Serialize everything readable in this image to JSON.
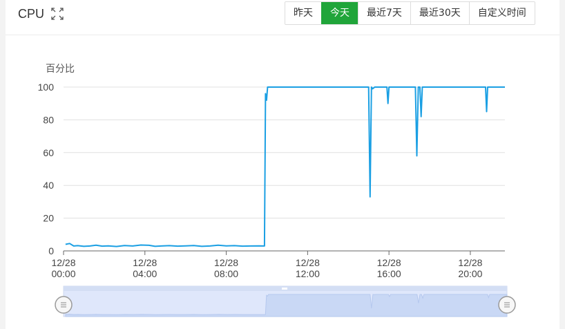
{
  "header": {
    "title": "CPU",
    "range_buttons": [
      {
        "label": "昨天",
        "active": false
      },
      {
        "label": "今天",
        "active": true
      },
      {
        "label": "最近7天",
        "active": false
      },
      {
        "label": "最近30天",
        "active": false
      },
      {
        "label": "自定义时间",
        "active": false
      }
    ]
  },
  "colors": {
    "accent": "#20a53a",
    "line": "#1a9fe3",
    "grid": "#e0e0e0",
    "zoom_fill": "#c9d8f5",
    "zoom_band": "#dfe7fb"
  },
  "icons": {
    "expand": "expand-icon",
    "zoom_handle": "zoom-handle-icon"
  },
  "chart_data": {
    "type": "line",
    "ylabel": "百分比",
    "xlabel": "",
    "ylim": [
      0,
      100
    ],
    "y_ticks": [
      "0",
      "20",
      "40",
      "60",
      "80",
      "100"
    ],
    "x_ticks": [
      {
        "date": "12/28",
        "time": "00:00",
        "hour": 0
      },
      {
        "date": "12/28",
        "time": "04:00",
        "hour": 4
      },
      {
        "date": "12/28",
        "time": "08:00",
        "hour": 8
      },
      {
        "date": "12/28",
        "time": "12:00",
        "hour": 12
      },
      {
        "date": "12/28",
        "time": "16:00",
        "hour": 16
      },
      {
        "date": "12/28",
        "time": "20:00",
        "hour": 20
      }
    ],
    "xlim_hours": [
      0,
      21.7
    ],
    "grid": true,
    "legend": "none",
    "series": [
      {
        "points": [
          [
            0.1,
            4
          ],
          [
            0.3,
            4.5
          ],
          [
            0.5,
            3
          ],
          [
            0.7,
            3.2
          ],
          [
            1.0,
            2.8
          ],
          [
            1.3,
            3
          ],
          [
            1.6,
            3.5
          ],
          [
            1.9,
            2.9
          ],
          [
            2.2,
            3.1
          ],
          [
            2.6,
            2.7
          ],
          [
            3.0,
            3.3
          ],
          [
            3.4,
            3
          ],
          [
            3.8,
            3.6
          ],
          [
            4.2,
            3.4
          ],
          [
            4.5,
            2.8
          ],
          [
            4.8,
            3
          ],
          [
            5.2,
            3.2
          ],
          [
            5.6,
            2.9
          ],
          [
            6.0,
            3.1
          ],
          [
            6.4,
            3.3
          ],
          [
            6.8,
            2.8
          ],
          [
            7.2,
            3
          ],
          [
            7.6,
            3.5
          ],
          [
            8.0,
            3.1
          ],
          [
            8.4,
            3.2
          ],
          [
            8.8,
            2.9
          ],
          [
            9.2,
            3
          ],
          [
            9.6,
            3.1
          ],
          [
            9.88,
            3
          ],
          [
            9.93,
            96
          ],
          [
            9.98,
            92
          ],
          [
            10.03,
            100
          ],
          [
            11.0,
            100
          ],
          [
            12.0,
            100
          ],
          [
            13.0,
            100
          ],
          [
            14.0,
            100
          ],
          [
            14.9,
            100
          ],
          [
            15.0,
            100
          ],
          [
            15.07,
            33
          ],
          [
            15.14,
            100
          ],
          [
            15.2,
            99
          ],
          [
            15.3,
            100
          ],
          [
            15.9,
            100
          ],
          [
            15.95,
            90
          ],
          [
            16.0,
            100
          ],
          [
            17.3,
            100
          ],
          [
            17.37,
            58
          ],
          [
            17.44,
            100
          ],
          [
            17.52,
            100
          ],
          [
            17.58,
            82
          ],
          [
            17.64,
            100
          ],
          [
            18.8,
            100
          ],
          [
            19.5,
            100
          ],
          [
            20.75,
            100
          ],
          [
            20.8,
            85
          ],
          [
            20.85,
            100
          ],
          [
            21.7,
            100
          ]
        ]
      }
    ]
  },
  "zoom": {
    "range_start_pct": 0,
    "range_end_pct": 100
  }
}
